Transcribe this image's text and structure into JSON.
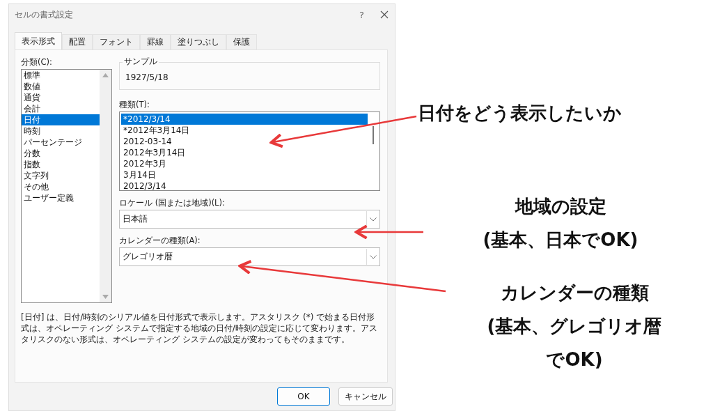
{
  "window": {
    "title": "セルの書式設定",
    "help": "?"
  },
  "tabs": [
    {
      "label": "表示形式",
      "selected": true
    },
    {
      "label": "配置",
      "selected": false
    },
    {
      "label": "フォント",
      "selected": false
    },
    {
      "label": "罫線",
      "selected": false
    },
    {
      "label": "塗りつぶし",
      "selected": false
    },
    {
      "label": "保護",
      "selected": false
    }
  ],
  "category": {
    "label": "分類(C):",
    "items": [
      {
        "label": "標準",
        "selected": false
      },
      {
        "label": "数値",
        "selected": false
      },
      {
        "label": "通貨",
        "selected": false
      },
      {
        "label": "会計",
        "selected": false
      },
      {
        "label": "日付",
        "selected": true
      },
      {
        "label": "時刻",
        "selected": false
      },
      {
        "label": "パーセンテージ",
        "selected": false
      },
      {
        "label": "分数",
        "selected": false
      },
      {
        "label": "指数",
        "selected": false
      },
      {
        "label": "文字列",
        "selected": false
      },
      {
        "label": "その他",
        "selected": false
      },
      {
        "label": "ユーザー定義",
        "selected": false
      }
    ]
  },
  "sample": {
    "label": "サンプル",
    "value": "1927/5/18"
  },
  "type": {
    "label": "種類(T):",
    "items": [
      {
        "label": "*2012/3/14",
        "selected": true
      },
      {
        "label": "*2012年3月14日",
        "selected": false
      },
      {
        "label": "2012-03-14",
        "selected": false
      },
      {
        "label": "2012年3月14日",
        "selected": false
      },
      {
        "label": "2012年3月",
        "selected": false
      },
      {
        "label": "3月14日",
        "selected": false
      },
      {
        "label": "2012/3/14",
        "selected": false
      }
    ]
  },
  "locale": {
    "label": "ロケール (国または地域)(L):",
    "value": "日本語"
  },
  "calendar": {
    "label": "カレンダーの種類(A):",
    "value": "グレゴリオ暦"
  },
  "description": "[日付] は、日付/時刻のシリアル値を日付形式で表示します。アスタリスク (*) で始まる日付形式は、オペレーティング システムで指定する地域の日付/時刻の設定に応じて変わります。アスタリスクのない形式は、オペレーティング システムの設定が変わってもそのままです。",
  "buttons": [
    {
      "label": "OK",
      "selected": true
    },
    {
      "label": "キャンセル",
      "selected": false
    }
  ],
  "annotations": [
    {
      "lines": [
        "日付をどう表示したいか"
      ]
    },
    {
      "lines": [
        "地域の設定",
        "(基本、日本でOK)"
      ]
    },
    {
      "lines": [
        "カレンダーの種類",
        "(基本、グレゴリオ暦",
        "でOK)"
      ]
    }
  ]
}
